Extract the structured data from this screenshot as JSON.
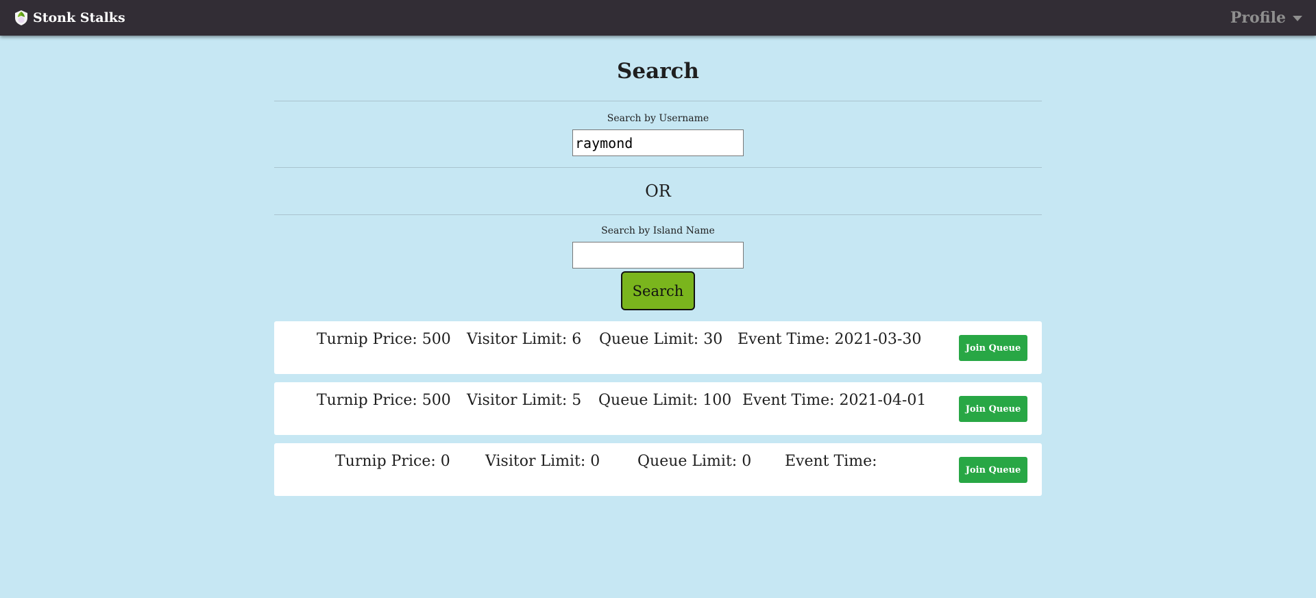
{
  "nav": {
    "brand": "Stonk Stalks",
    "profile": "Profile"
  },
  "page": {
    "title": "Search"
  },
  "search": {
    "username_label": "Search by Username",
    "username_value": "raymond",
    "or_text": "OR",
    "island_label": "Search by Island Name",
    "island_value": "",
    "button_label": "Search"
  },
  "results": [
    {
      "turnip_price": "Turnip Price: 500",
      "visitor_limit": "Visitor Limit: 6",
      "queue_limit": "Queue Limit: 30",
      "event_time": "Event Time: 2021-03-30",
      "button": "Join Queue"
    },
    {
      "turnip_price": "Turnip Price: 500",
      "visitor_limit": "Visitor Limit: 5",
      "queue_limit": "Queue Limit: 100",
      "event_time": "Event Time: 2021-04-01",
      "button": "Join Queue"
    },
    {
      "turnip_price": "Turnip Price: 0",
      "visitor_limit": "Visitor Limit: 0",
      "queue_limit": "Queue Limit: 0",
      "event_time": "Event Time:",
      "button": "Join Queue"
    }
  ],
  "colors": {
    "navbar": "#322d35",
    "background": "#c6e7f3",
    "search_button": "#7ab51d",
    "join_button": "#28a745"
  },
  "icons": {
    "brand": "turnip-shield-icon",
    "profile": "chevron-down-icon"
  }
}
